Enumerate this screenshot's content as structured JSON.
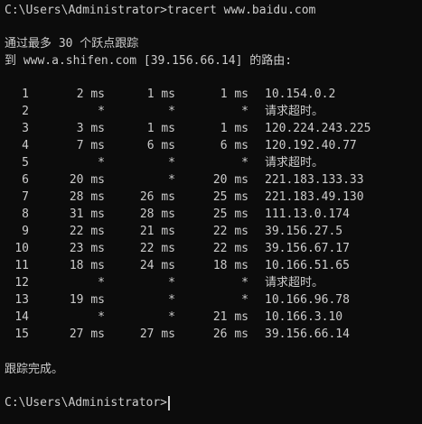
{
  "console": {
    "command_line": "C:\\Users\\Administrator>tracert www.baidu.com",
    "header_line1": "通过最多 30 个跃点跟踪",
    "header_line2": "到 www.a.shifen.com [39.156.66.14] 的路由:",
    "hops": [
      {
        "hop": "1",
        "r1": "2 ms",
        "r2": "1 ms",
        "r3": "1 ms",
        "host": "10.154.0.2"
      },
      {
        "hop": "2",
        "r1": "*",
        "r2": "*",
        "r3": "*",
        "host": "请求超时。"
      },
      {
        "hop": "3",
        "r1": "3 ms",
        "r2": "1 ms",
        "r3": "1 ms",
        "host": "120.224.243.225"
      },
      {
        "hop": "4",
        "r1": "7 ms",
        "r2": "6 ms",
        "r3": "6 ms",
        "host": "120.192.40.77"
      },
      {
        "hop": "5",
        "r1": "*",
        "r2": "*",
        "r3": "*",
        "host": "请求超时。"
      },
      {
        "hop": "6",
        "r1": "20 ms",
        "r2": "*",
        "r3": "20 ms",
        "host": "221.183.133.33"
      },
      {
        "hop": "7",
        "r1": "28 ms",
        "r2": "26 ms",
        "r3": "25 ms",
        "host": "221.183.49.130"
      },
      {
        "hop": "8",
        "r1": "31 ms",
        "r2": "28 ms",
        "r3": "25 ms",
        "host": "111.13.0.174"
      },
      {
        "hop": "9",
        "r1": "22 ms",
        "r2": "21 ms",
        "r3": "22 ms",
        "host": "39.156.27.5"
      },
      {
        "hop": "10",
        "r1": "23 ms",
        "r2": "22 ms",
        "r3": "22 ms",
        "host": "39.156.67.17"
      },
      {
        "hop": "11",
        "r1": "18 ms",
        "r2": "24 ms",
        "r3": "18 ms",
        "host": "10.166.51.65"
      },
      {
        "hop": "12",
        "r1": "*",
        "r2": "*",
        "r3": "*",
        "host": "请求超时。"
      },
      {
        "hop": "13",
        "r1": "19 ms",
        "r2": "*",
        "r3": "*",
        "host": "10.166.96.78"
      },
      {
        "hop": "14",
        "r1": "*",
        "r2": "*",
        "r3": "21 ms",
        "host": "10.166.3.10"
      },
      {
        "hop": "15",
        "r1": "27 ms",
        "r2": "27 ms",
        "r3": "26 ms",
        "host": "39.156.66.14"
      }
    ],
    "trace_complete": "跟踪完成。",
    "prompt": "C:\\Users\\Administrator>"
  },
  "colors": {
    "background": "#0c0c0c",
    "foreground": "#cccccc"
  }
}
